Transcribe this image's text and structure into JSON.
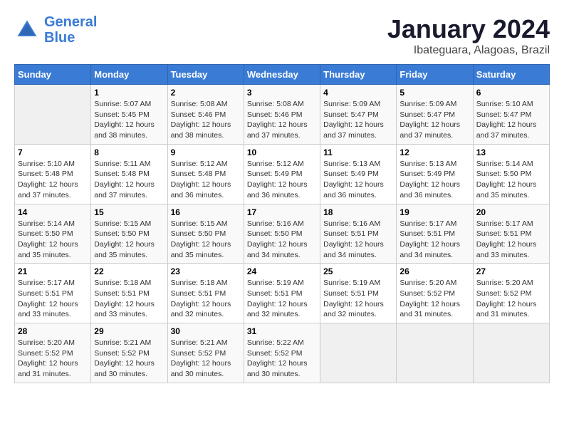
{
  "header": {
    "logo_line1": "General",
    "logo_line2": "Blue",
    "title": "January 2024",
    "subtitle": "Ibateguara, Alagoas, Brazil"
  },
  "columns": [
    "Sunday",
    "Monday",
    "Tuesday",
    "Wednesday",
    "Thursday",
    "Friday",
    "Saturday"
  ],
  "weeks": [
    [
      {
        "day": "",
        "sunrise": "",
        "sunset": "",
        "daylight": ""
      },
      {
        "day": "1",
        "sunrise": "5:07 AM",
        "sunset": "5:45 PM",
        "daylight": "12 hours and 38 minutes."
      },
      {
        "day": "2",
        "sunrise": "5:08 AM",
        "sunset": "5:46 PM",
        "daylight": "12 hours and 38 minutes."
      },
      {
        "day": "3",
        "sunrise": "5:08 AM",
        "sunset": "5:46 PM",
        "daylight": "12 hours and 37 minutes."
      },
      {
        "day": "4",
        "sunrise": "5:09 AM",
        "sunset": "5:47 PM",
        "daylight": "12 hours and 37 minutes."
      },
      {
        "day": "5",
        "sunrise": "5:09 AM",
        "sunset": "5:47 PM",
        "daylight": "12 hours and 37 minutes."
      },
      {
        "day": "6",
        "sunrise": "5:10 AM",
        "sunset": "5:47 PM",
        "daylight": "12 hours and 37 minutes."
      }
    ],
    [
      {
        "day": "7",
        "sunrise": "5:10 AM",
        "sunset": "5:48 PM",
        "daylight": "12 hours and 37 minutes."
      },
      {
        "day": "8",
        "sunrise": "5:11 AM",
        "sunset": "5:48 PM",
        "daylight": "12 hours and 37 minutes."
      },
      {
        "day": "9",
        "sunrise": "5:12 AM",
        "sunset": "5:48 PM",
        "daylight": "12 hours and 36 minutes."
      },
      {
        "day": "10",
        "sunrise": "5:12 AM",
        "sunset": "5:49 PM",
        "daylight": "12 hours and 36 minutes."
      },
      {
        "day": "11",
        "sunrise": "5:13 AM",
        "sunset": "5:49 PM",
        "daylight": "12 hours and 36 minutes."
      },
      {
        "day": "12",
        "sunrise": "5:13 AM",
        "sunset": "5:49 PM",
        "daylight": "12 hours and 36 minutes."
      },
      {
        "day": "13",
        "sunrise": "5:14 AM",
        "sunset": "5:50 PM",
        "daylight": "12 hours and 35 minutes."
      }
    ],
    [
      {
        "day": "14",
        "sunrise": "5:14 AM",
        "sunset": "5:50 PM",
        "daylight": "12 hours and 35 minutes."
      },
      {
        "day": "15",
        "sunrise": "5:15 AM",
        "sunset": "5:50 PM",
        "daylight": "12 hours and 35 minutes."
      },
      {
        "day": "16",
        "sunrise": "5:15 AM",
        "sunset": "5:50 PM",
        "daylight": "12 hours and 35 minutes."
      },
      {
        "day": "17",
        "sunrise": "5:16 AM",
        "sunset": "5:50 PM",
        "daylight": "12 hours and 34 minutes."
      },
      {
        "day": "18",
        "sunrise": "5:16 AM",
        "sunset": "5:51 PM",
        "daylight": "12 hours and 34 minutes."
      },
      {
        "day": "19",
        "sunrise": "5:17 AM",
        "sunset": "5:51 PM",
        "daylight": "12 hours and 34 minutes."
      },
      {
        "day": "20",
        "sunrise": "5:17 AM",
        "sunset": "5:51 PM",
        "daylight": "12 hours and 33 minutes."
      }
    ],
    [
      {
        "day": "21",
        "sunrise": "5:17 AM",
        "sunset": "5:51 PM",
        "daylight": "12 hours and 33 minutes."
      },
      {
        "day": "22",
        "sunrise": "5:18 AM",
        "sunset": "5:51 PM",
        "daylight": "12 hours and 33 minutes."
      },
      {
        "day": "23",
        "sunrise": "5:18 AM",
        "sunset": "5:51 PM",
        "daylight": "12 hours and 32 minutes."
      },
      {
        "day": "24",
        "sunrise": "5:19 AM",
        "sunset": "5:51 PM",
        "daylight": "12 hours and 32 minutes."
      },
      {
        "day": "25",
        "sunrise": "5:19 AM",
        "sunset": "5:51 PM",
        "daylight": "12 hours and 32 minutes."
      },
      {
        "day": "26",
        "sunrise": "5:20 AM",
        "sunset": "5:52 PM",
        "daylight": "12 hours and 31 minutes."
      },
      {
        "day": "27",
        "sunrise": "5:20 AM",
        "sunset": "5:52 PM",
        "daylight": "12 hours and 31 minutes."
      }
    ],
    [
      {
        "day": "28",
        "sunrise": "5:20 AM",
        "sunset": "5:52 PM",
        "daylight": "12 hours and 31 minutes."
      },
      {
        "day": "29",
        "sunrise": "5:21 AM",
        "sunset": "5:52 PM",
        "daylight": "12 hours and 30 minutes."
      },
      {
        "day": "30",
        "sunrise": "5:21 AM",
        "sunset": "5:52 PM",
        "daylight": "12 hours and 30 minutes."
      },
      {
        "day": "31",
        "sunrise": "5:22 AM",
        "sunset": "5:52 PM",
        "daylight": "12 hours and 30 minutes."
      },
      {
        "day": "",
        "sunrise": "",
        "sunset": "",
        "daylight": ""
      },
      {
        "day": "",
        "sunrise": "",
        "sunset": "",
        "daylight": ""
      },
      {
        "day": "",
        "sunrise": "",
        "sunset": "",
        "daylight": ""
      }
    ]
  ]
}
